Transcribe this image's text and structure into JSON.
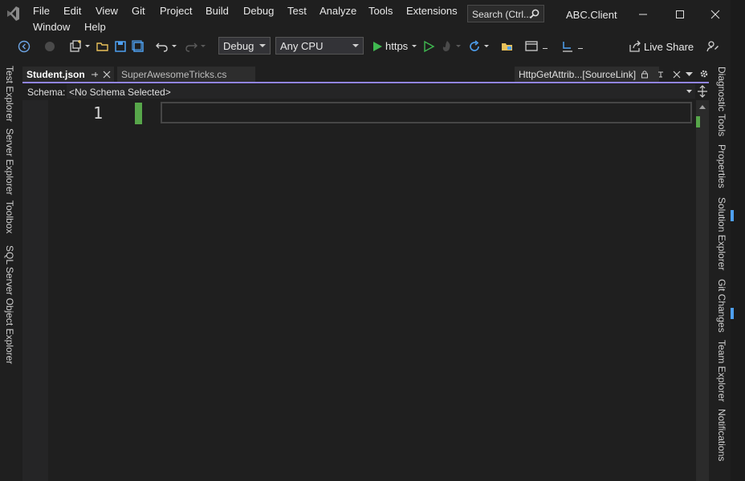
{
  "menu": {
    "items": [
      "File",
      "Edit",
      "View",
      "Git",
      "Project",
      "Build",
      "Debug",
      "Test",
      "Analyze",
      "Tools",
      "Extensions",
      "Window",
      "Help"
    ]
  },
  "search": {
    "label": "Search (Ctrl..."
  },
  "window": {
    "title": "ABC.Client"
  },
  "toolbar": {
    "config": "Debug",
    "platform": "Any CPU",
    "run_target": "https",
    "live_share": "Live Share"
  },
  "left_rail": {
    "tabs": [
      "Test Explorer",
      "Server Explorer",
      "Toolbox",
      "SQL Server Object Explorer"
    ]
  },
  "right_rail": {
    "tabs": [
      "Diagnostic Tools",
      "Properties",
      "Solution Explorer",
      "Git Changes",
      "Team Explorer",
      "Notifications"
    ]
  },
  "tabs": {
    "active": "Student.json",
    "inactive": "SuperAwesomeTricks.cs",
    "preview": "HttpGetAttrib...[SourceLink]"
  },
  "schema": {
    "label": "Schema:",
    "value": "<No Schema Selected>"
  },
  "editor": {
    "line_number": "1"
  },
  "colors": {
    "accent": "#9184e6",
    "change_bar": "#57a64a",
    "run_green": "#3fb950"
  }
}
